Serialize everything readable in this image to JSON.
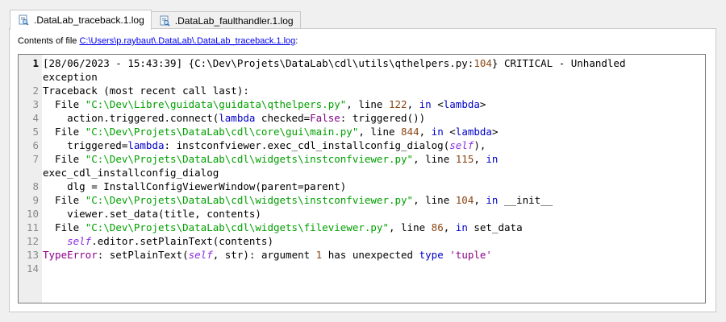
{
  "tabs": [
    {
      "label": ".DataLab_traceback.1.log",
      "active": true
    },
    {
      "label": ".DataLab_faulthandler.1.log",
      "active": false
    }
  ],
  "file_info": {
    "prefix": "Contents of file ",
    "path": "C:\\Users\\p.raybaut\\.DataLab\\.DataLab_traceback.1.log",
    "suffix": ":"
  },
  "editor": {
    "line_numbers": [
      "1",
      "2",
      "3",
      "4",
      "5",
      "6",
      "7",
      "8",
      "9",
      "10",
      "11",
      "12",
      "13",
      "14"
    ],
    "lines": [
      "[28/06/2023 - 15:43:39] {C:\\Dev\\Projets\\DataLab\\cdl\\utils\\qthelpers.py:104} CRITICAL - Unhandled",
      "exception",
      "Traceback (most recent call last):",
      "  File \"C:\\Dev\\Libre\\guidata\\guidata\\qthelpers.py\", line 122, in <lambda>",
      "    action.triggered.connect(lambda checked=False: triggered())",
      "  File \"C:\\Dev\\Projets\\DataLab\\cdl\\core\\gui\\main.py\", line 844, in <lambda>",
      "    triggered=lambda: instconfviewer.exec_cdl_installconfig_dialog(self),",
      "  File \"C:\\Dev\\Projets\\DataLab\\cdl\\widgets\\instconfviewer.py\", line 115, in",
      "exec_cdl_installconfig_dialog",
      "    dlg = InstallConfigViewerWindow(parent=parent)",
      "  File \"C:\\Dev\\Projets\\DataLab\\cdl\\widgets\\instconfviewer.py\", line 104, in __init__",
      "    viewer.set_data(title, contents)",
      "  File \"C:\\Dev\\Projets\\DataLab\\cdl\\widgets\\fileviewer.py\", line 86, in set_data",
      "    self.editor.setPlainText(contents)",
      "TypeError: setPlainText(self, str): argument 1 has unexpected type 'tuple'",
      ""
    ]
  },
  "colors": {
    "string": "#00a000",
    "keyword": "#0000c8",
    "self": "#8a2be2",
    "number": "#8b4513",
    "error": "#8b008b",
    "link": "#0000ee"
  }
}
